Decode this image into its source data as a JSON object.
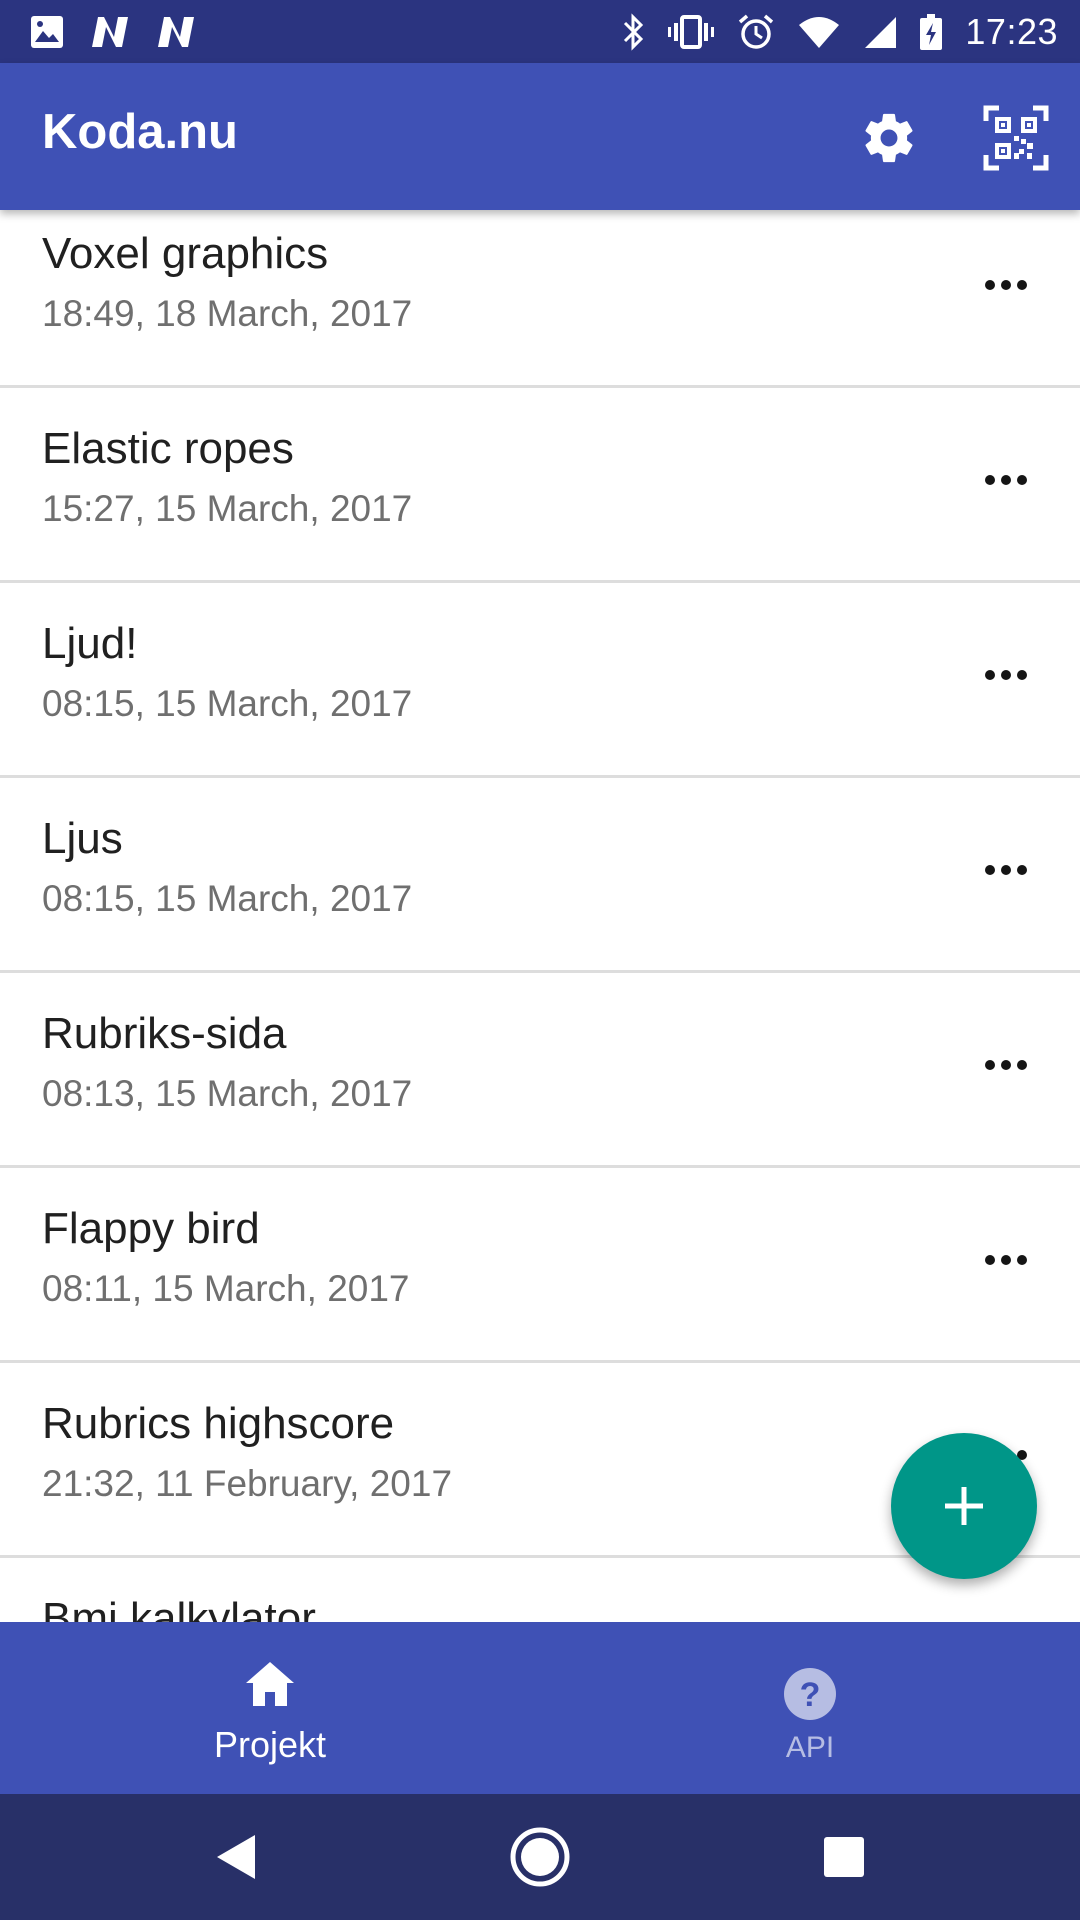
{
  "status_bar": {
    "time": "17:23",
    "left_icons": [
      "image-icon",
      "n-logo-icon",
      "n-logo-icon"
    ],
    "right_icons": [
      "bluetooth-icon",
      "vibrate-icon",
      "alarm-icon",
      "wifi-icon",
      "signal-icon",
      "battery-charging-icon"
    ]
  },
  "app_bar": {
    "title": "Koda.nu",
    "actions": [
      "gear-icon",
      "qr-code-icon"
    ]
  },
  "projects": [
    {
      "title": "Voxel graphics",
      "date": "18:49, 18 March, 2017"
    },
    {
      "title": "Elastic ropes",
      "date": "15:27, 15 March, 2017"
    },
    {
      "title": "Ljud!",
      "date": "08:15, 15 March, 2017"
    },
    {
      "title": "Ljus",
      "date": "08:15, 15 March, 2017"
    },
    {
      "title": "Rubriks-sida",
      "date": "08:13, 15 March, 2017"
    },
    {
      "title": "Flappy bird",
      "date": "08:11, 15 March, 2017"
    },
    {
      "title": "Rubrics highscore",
      "date": "21:32, 11 February, 2017"
    },
    {
      "title": "Bmi kalkylator",
      "date": ""
    }
  ],
  "fab": {
    "icon": "plus-icon"
  },
  "bottom_nav": [
    {
      "label": "Projekt",
      "icon": "home-icon",
      "active": true
    },
    {
      "label": "API",
      "icon": "help-circle-icon",
      "active": false
    }
  ],
  "system_nav": [
    "back-icon",
    "home-circle-icon",
    "recents-icon"
  ],
  "colors": {
    "status_bar": "#2b3480",
    "primary": "#3f51b5",
    "accent": "#009688",
    "system_nav": "#283068"
  }
}
